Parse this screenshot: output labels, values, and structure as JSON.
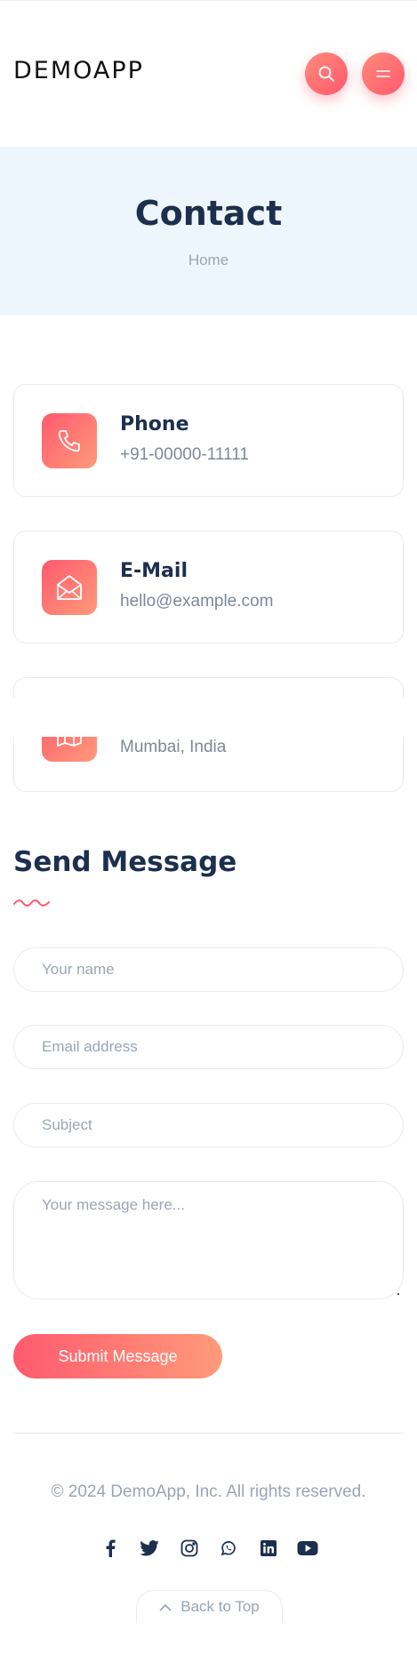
{
  "header": {
    "logo_text": "DEMOAPP",
    "search_icon": "search-icon",
    "menu_icon": "menu-icon",
    "accent_color": "#ff5a6e"
  },
  "hero": {
    "title": "Contact",
    "breadcrumb": "Home"
  },
  "contact_cards": [
    {
      "icon": "phone-icon",
      "title": "Phone",
      "value": "+91-00000-11111"
    },
    {
      "icon": "mail-icon",
      "title": "E-Mail",
      "value": "hello@example.com"
    },
    {
      "icon": "map-icon",
      "title": "",
      "value": "Mumbai, India"
    }
  ],
  "form": {
    "title": "Send Message",
    "name_placeholder": "Your name",
    "email_placeholder": "Email address",
    "subject_placeholder": "Subject",
    "message_placeholder": "Your message here...",
    "submit_label": "Submit Message"
  },
  "footer": {
    "copyright": "© 2024 DemoApp, Inc. All rights reserved.",
    "social_icons": [
      "facebook-icon",
      "twitter-icon",
      "instagram-icon",
      "whatsapp-icon",
      "linkedin-icon",
      "youtube-icon"
    ],
    "back_to_top": "Back to Top"
  }
}
